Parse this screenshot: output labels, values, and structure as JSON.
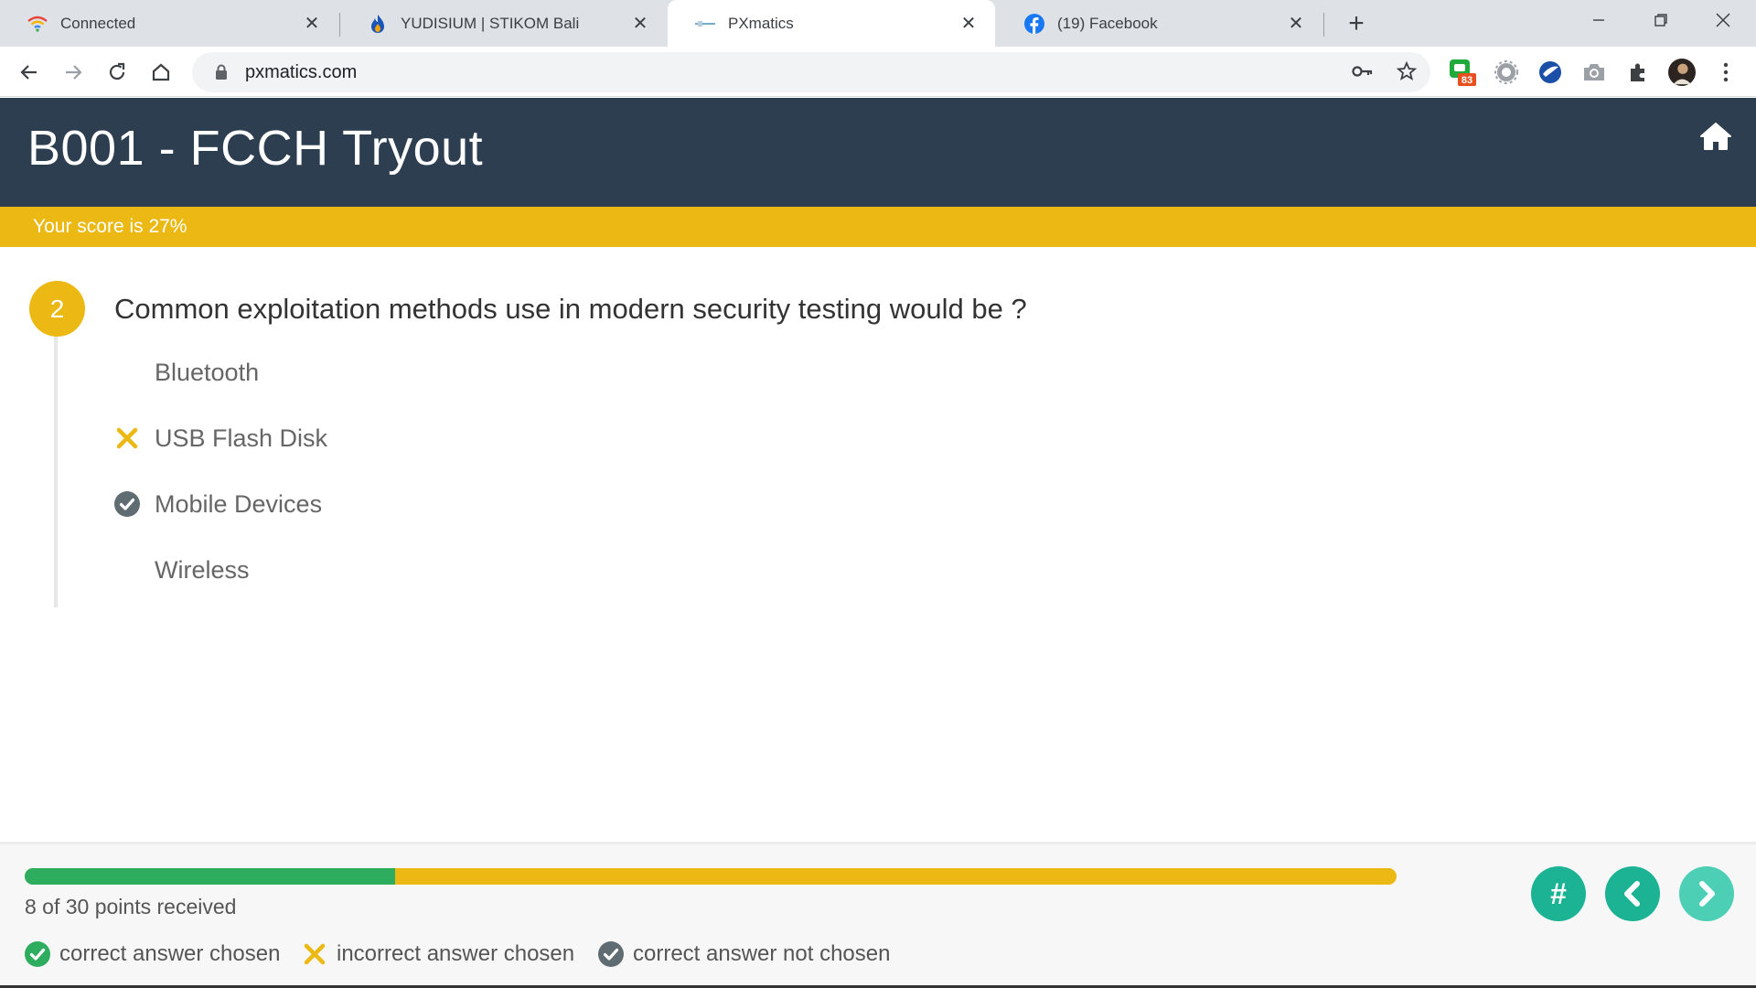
{
  "browser": {
    "tabs": [
      {
        "title": "Connected",
        "icon": "wifi-icon"
      },
      {
        "title": "YUDISIUM | STIKOM Bali",
        "icon": "flame-icon"
      },
      {
        "title": "PXmatics",
        "icon": "pxmatics-icon",
        "active": true
      },
      {
        "title": "(19) Facebook",
        "icon": "facebook-icon"
      }
    ],
    "url": "pxmatics.com",
    "extension_badge": "83"
  },
  "page": {
    "title": "B001 - FCCH Tryout",
    "score_text": "Your score is 27%"
  },
  "question": {
    "number": "2",
    "text": "Common exploitation methods use in modern security testing would be ?",
    "answers": [
      {
        "label": "Bluetooth",
        "status": "none"
      },
      {
        "label": "USB Flash Disk",
        "status": "incorrect-chosen"
      },
      {
        "label": "Mobile Devices",
        "status": "correct-not-chosen"
      },
      {
        "label": "Wireless",
        "status": "none"
      }
    ]
  },
  "footer": {
    "points_text": "8 of 30 points received",
    "progress_fraction": 0.27,
    "legend": {
      "correct_chosen": "correct answer chosen",
      "incorrect_chosen": "incorrect answer chosen",
      "correct_not_chosen": "correct answer not chosen"
    },
    "buttons": {
      "overview": "#"
    }
  },
  "colors": {
    "header_bg": "#2c3e50",
    "accent_yellow": "#ebb814",
    "progress_green": "#2ead5e",
    "nav_teal": "#1bb394",
    "icon_gray": "#5f6c72"
  }
}
